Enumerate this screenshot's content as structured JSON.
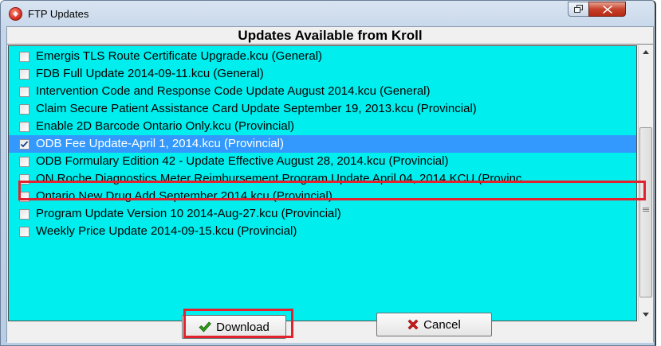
{
  "window": {
    "title": "FTP Updates",
    "icon": "app-icon",
    "restore_icon": "restore-icon",
    "close_icon": "close-icon"
  },
  "header": {
    "title": "Updates Available from Kroll"
  },
  "updates": [
    {
      "label": "Emergis TLS Route Certificate Upgrade.kcu (General)",
      "checked": false
    },
    {
      "label": "FDB Full Update 2014-09-11.kcu (General)",
      "checked": false
    },
    {
      "label": "Intervention Code and Response Code Update August 2014.kcu (General)",
      "checked": false
    },
    {
      "label": "Claim Secure Patient Assistance Card Update September 19, 2013.kcu (Provincial)",
      "checked": false
    },
    {
      "label": "Enable 2D Barcode Ontario Only.kcu (Provincial)",
      "checked": false
    },
    {
      "label": "ODB Fee Update-April 1, 2014.kcu (Provincial)",
      "checked": true,
      "selected": true
    },
    {
      "label": "ODB Formulary Edition 42 - Update Effective August 28, 2014.kcu (Provincial)",
      "checked": false
    },
    {
      "label": "ON Roche Diagnostics Meter  Reimbursement Program Update April 04, 2014.KCU (Provinc",
      "checked": false
    },
    {
      "label": "Ontario New Drug Add September 2014.kcu (Provincial)",
      "checked": false
    },
    {
      "label": "Program Update Version 10 2014-Aug-27.kcu (Provincial)",
      "checked": false
    },
    {
      "label": "Weekly Price Update 2014-09-15.kcu (Provincial)",
      "checked": false
    }
  ],
  "buttons": {
    "download_label": "Download",
    "download_icon": "checkmark-icon",
    "cancel_label": "Cancel",
    "cancel_icon": "x-icon"
  },
  "colors": {
    "list_background": "#00eeee",
    "selected_row": "#3399ff",
    "highlight_outline": "#e0232e",
    "checkmark": "#2e9a1a",
    "cancel_x": "#cc1a1a"
  }
}
